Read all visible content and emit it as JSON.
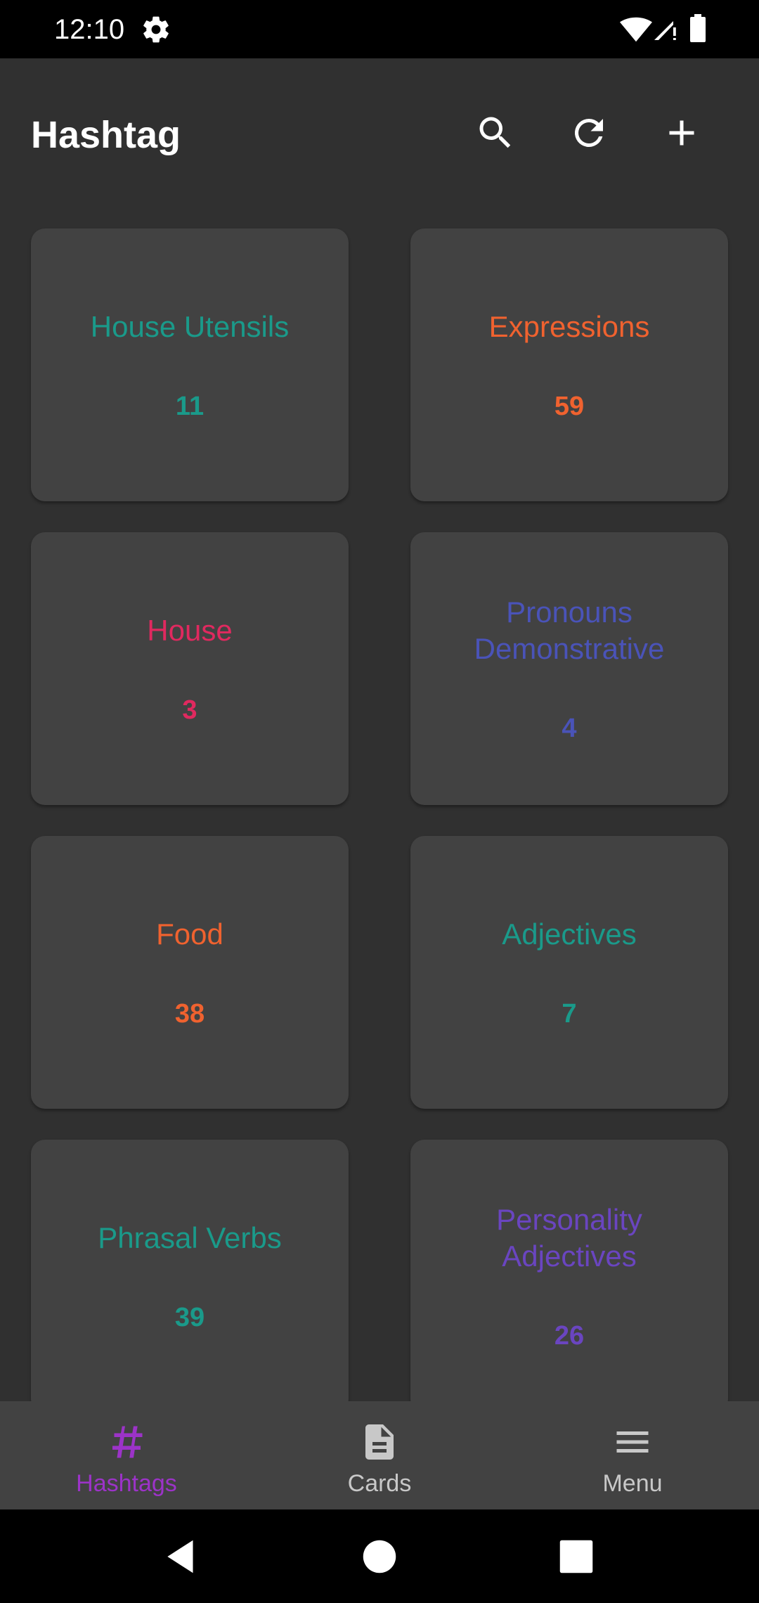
{
  "status_bar": {
    "time": "12:10"
  },
  "app_bar": {
    "title": "Hashtag"
  },
  "cards": [
    {
      "title": "House Utensils",
      "count": "11",
      "color": "#1a9a8a"
    },
    {
      "title": "Expressions",
      "count": "59",
      "color": "#f0622f"
    },
    {
      "title": "House",
      "count": "3",
      "color": "#e0295f"
    },
    {
      "title": "Pronouns Demonstrative",
      "count": "4",
      "color": "#4a53b8"
    },
    {
      "title": "Food",
      "count": "38",
      "color": "#f0622f"
    },
    {
      "title": "Adjectives",
      "count": "7",
      "color": "#1a9a8a"
    },
    {
      "title": "Phrasal Verbs",
      "count": "39",
      "color": "#1a9a8a"
    },
    {
      "title": "Personality Adjectives",
      "count": "26",
      "color": "#6a45c0"
    }
  ],
  "bottom_nav": {
    "items": [
      {
        "label": "Hashtags",
        "icon": "hashtag-icon",
        "active": true,
        "color": "#9c33c8"
      },
      {
        "label": "Cards",
        "icon": "document-icon",
        "active": false,
        "color": "#c8c8c8"
      },
      {
        "label": "Menu",
        "icon": "menu-icon",
        "active": false,
        "color": "#c8c8c8"
      }
    ]
  }
}
